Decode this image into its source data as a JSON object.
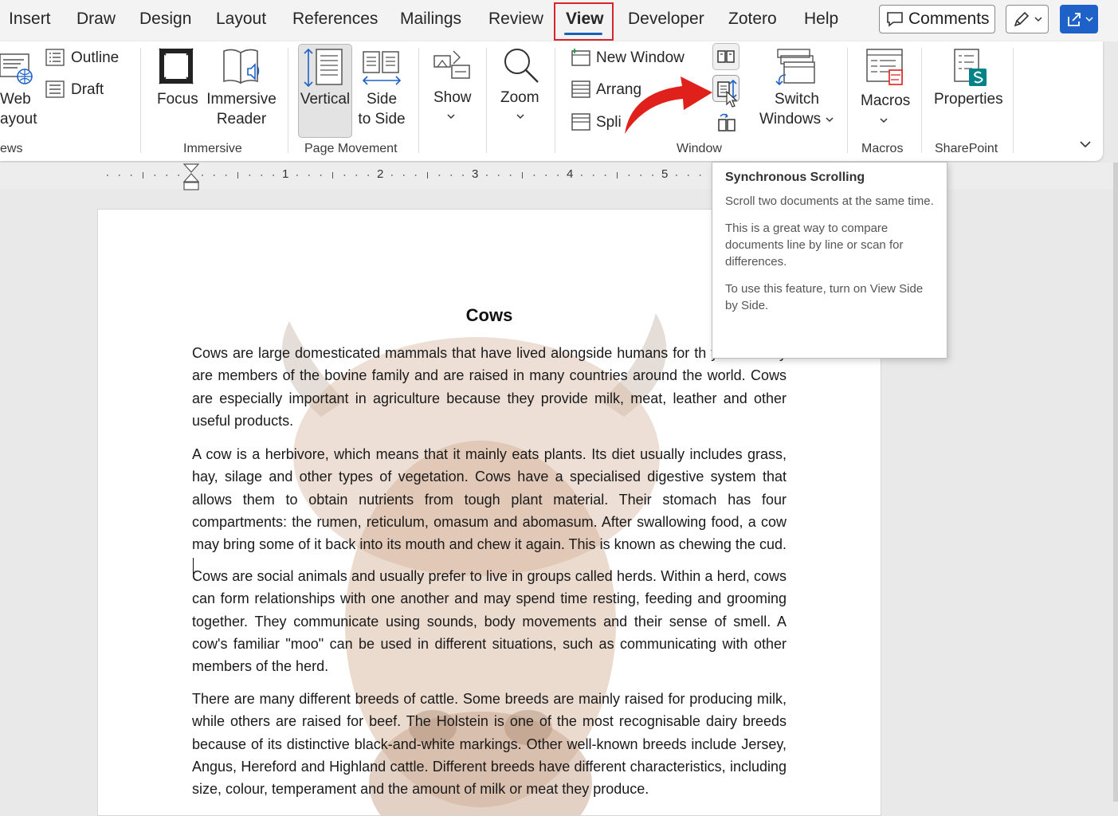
{
  "tabs": [
    "Insert",
    "Draw",
    "Design",
    "Layout",
    "References",
    "Mailings",
    "Review",
    "View",
    "Developer",
    "Zotero",
    "Help"
  ],
  "active_tab": "View",
  "topbar": {
    "comments_label": "Comments"
  },
  "ribbon": {
    "views": {
      "web_layout_line1": "Web",
      "web_layout_line2": "ayout",
      "outline": "Outline",
      "draft": "Draft",
      "group": "ews"
    },
    "immersive": {
      "focus": "Focus",
      "reader_line1": "Immersive",
      "reader_line2": "Reader",
      "group": "Immersive"
    },
    "page_movement": {
      "vertical": "Vertical",
      "side_line1": "Side",
      "side_line2": "to Side",
      "group": "Page Movement"
    },
    "show": {
      "label": "Show"
    },
    "zoom": {
      "label": "Zoom"
    },
    "window": {
      "new_window": "New Window",
      "arrange": "Arrang",
      "split": "Spli",
      "switch_line1": "Switch",
      "switch_line2": "Windows",
      "group": "Window"
    },
    "macros": {
      "label": "Macros",
      "group": "Macros"
    },
    "sharepoint": {
      "label": "Properties",
      "group": "SharePoint"
    }
  },
  "ruler": {
    "marks": [
      "1",
      "2",
      "3",
      "4",
      "5"
    ]
  },
  "tooltip": {
    "title": "Synchronous Scrolling",
    "para1": "Scroll two documents at the same time.",
    "para2": "This is a great way to compare documents line by line or scan for differences.",
    "para3": "To use this feature, turn on View Side by Side."
  },
  "document": {
    "title": "Cows",
    "paragraphs": [
      "Cows are large domesticated mammals that have lived alongside humans for th years. They are members of the bovine family and are raised in many countries around the world. Cows are especially important in agriculture because they provide milk, meat, leather and other useful products.",
      "A cow is a herbivore, which means that it mainly eats plants. Its diet usually includes grass, hay, silage and other types of vegetation. Cows have a specialised digestive system that allows them to obtain nutrients from tough plant material. Their stomach has four compartments: the rumen, reticulum, omasum and abomasum. After swallowing food, a cow may bring some of it back into its mouth and chew it again. This is known as chewing the cud.",
      "Cows are social animals and usually prefer to live in groups called herds. Within a herd, cows can form relationships with one another and may spend time resting, feeding and grooming together. They communicate using sounds, body movements and their sense of smell. A cow's familiar \"moo\" can be used in different situations, such as communicating with other members of the herd.",
      "There are many different breeds of cattle. Some breeds are mainly raised for producing milk, while others are raised for beef. The Holstein is one of the most recognisable dairy breeds because of its distinctive black-and-white markings. Other well-known breeds include Jersey, Angus, Hereford and Highland cattle. Different breeds have different characteristics, including size, colour, temperament and the amount of milk or meat they produce."
    ]
  },
  "colors": {
    "accent": "#1a5fb4",
    "highlight": "#d9252a",
    "arrow": "#e0201b",
    "share": "#1e62c9"
  }
}
